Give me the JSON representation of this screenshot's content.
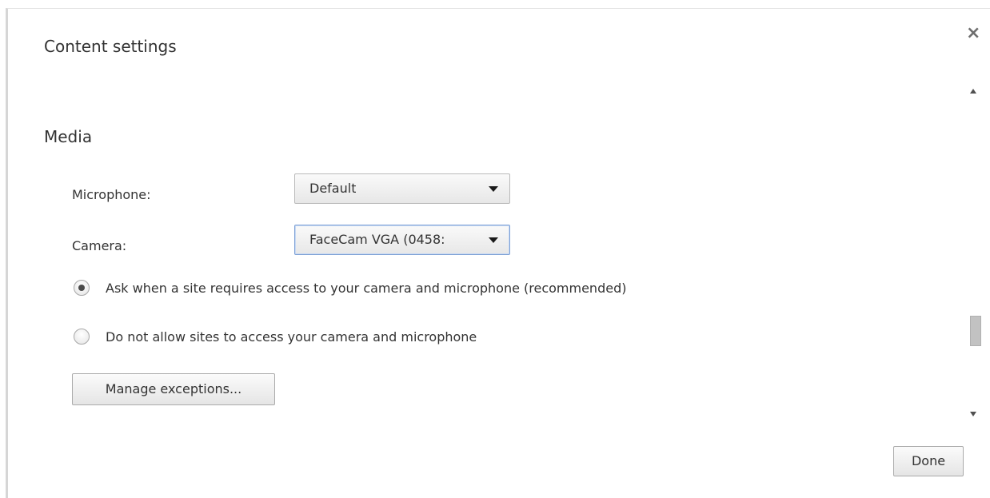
{
  "dialog": {
    "title": "Content settings",
    "close_icon": "close-icon",
    "done_label": "Done"
  },
  "media": {
    "section_title": "Media",
    "microphone_label": "Microphone:",
    "microphone_value": "Default",
    "camera_label": "Camera:",
    "camera_value": "FaceCam VGA (0458:",
    "radio_options": [
      {
        "label": "Ask when a site requires access to your camera and microphone (recommended)",
        "selected": true
      },
      {
        "label": "Do not allow sites to access your camera and microphone",
        "selected": false
      }
    ],
    "manage_exceptions_label": "Manage exceptions..."
  },
  "colors": {
    "focus_border": "#7ea1d6",
    "text": "#333333"
  }
}
